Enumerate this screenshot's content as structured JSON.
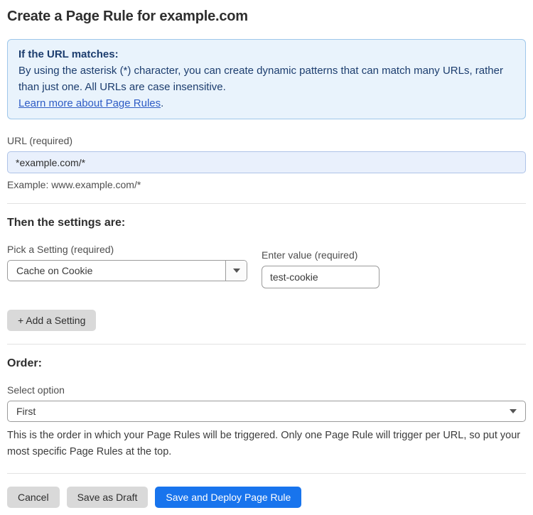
{
  "page": {
    "title": "Create a Page Rule for example.com"
  },
  "info_box": {
    "heading": "If the URL matches:",
    "body": "By using the asterisk (*) character, you can create dynamic patterns that can match many URLs, rather than just one. All URLs are case insensitive.",
    "link_label": "Learn more about Page Rules",
    "link_suffix": "."
  },
  "url_field": {
    "label": "URL (required)",
    "value": "*example.com/*",
    "helper": "Example: www.example.com/*"
  },
  "settings_section": {
    "heading": "Then the settings are:",
    "setting_label": "Pick a Setting (required)",
    "setting_value": "Cache on Cookie",
    "value_label": "Enter value (required)",
    "value_value": "test-cookie",
    "add_button_label": "+ Add a Setting"
  },
  "order_section": {
    "heading": "Order:",
    "select_label": "Select option",
    "selected_option": "First",
    "helper": "This is the order in which your Page Rules will be triggered. Only one Page Rule will trigger per URL, so put your most specific Page Rules at the top."
  },
  "footer": {
    "cancel_label": "Cancel",
    "save_draft_label": "Save as Draft",
    "save_deploy_label": "Save and Deploy Page Rule"
  },
  "icons": {
    "setting_dropdown_arrow": "chevron-down-icon",
    "order_dropdown_arrow": "chevron-down-icon"
  },
  "colors": {
    "info_box_bg": "#e9f3fc",
    "info_box_border": "#9ec7ea",
    "info_text": "#1c3d6e",
    "link_blue": "#2e5cc5",
    "url_input_bg": "#e9f0fc",
    "url_input_border": "#aec3e8",
    "primary_button": "#1874ed",
    "gray_button": "#d9d9d9"
  }
}
